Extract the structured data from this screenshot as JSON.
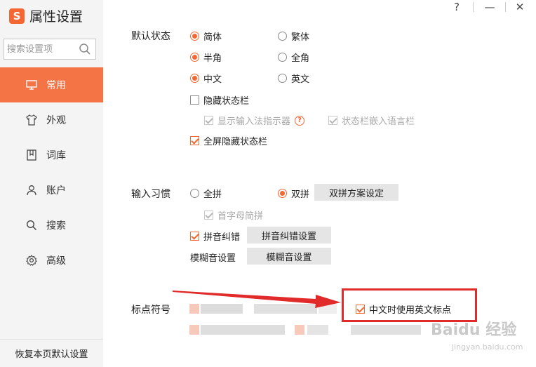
{
  "app": {
    "logo_char": "S",
    "title": "属性设置"
  },
  "search": {
    "placeholder": "搜索设置项"
  },
  "window": {
    "help": "?",
    "minimize": "—",
    "close": "✕"
  },
  "nav": [
    {
      "label": "常用",
      "icon": "monitor-icon",
      "active": true
    },
    {
      "label": "外观",
      "icon": "shirt-icon",
      "active": false
    },
    {
      "label": "词库",
      "icon": "book-icon",
      "active": false
    },
    {
      "label": "账户",
      "icon": "user-icon",
      "active": false
    },
    {
      "label": "搜索",
      "icon": "search-icon",
      "active": false
    },
    {
      "label": "高级",
      "icon": "gear-icon",
      "active": false
    }
  ],
  "restore_button": "恢复本页默认设置",
  "status": {
    "label": "默认状态",
    "simp": "简体",
    "trad": "繁体",
    "half": "半角",
    "full": "全角",
    "zh": "中文",
    "en": "英文",
    "hide_bar": "隐藏状态栏",
    "show_indicator": "显示输入法指示器",
    "embed_lang": "状态栏嵌入语言栏",
    "fullscreen_hide": "全屏隐藏状态栏"
  },
  "habit": {
    "label": "输入习惯",
    "quanpin": "全拼",
    "shuangpin": "双拼",
    "shuangpin_btn": "双拼方案设定",
    "initials": "首字母简拼",
    "correction": "拼音纠错",
    "correction_btn": "拼音纠错设置",
    "fuzzy_label": "模糊音设置",
    "fuzzy_btn": "模糊音设置"
  },
  "punct": {
    "label": "标点符号",
    "english_punct": "中文时使用英文标点"
  },
  "watermark": {
    "main": "Baidu 经验",
    "sub": "jingyan.baidu.com"
  },
  "colors": {
    "accent": "#f46632",
    "nav_active": "#f47446",
    "highlight": "#e12a2a"
  }
}
